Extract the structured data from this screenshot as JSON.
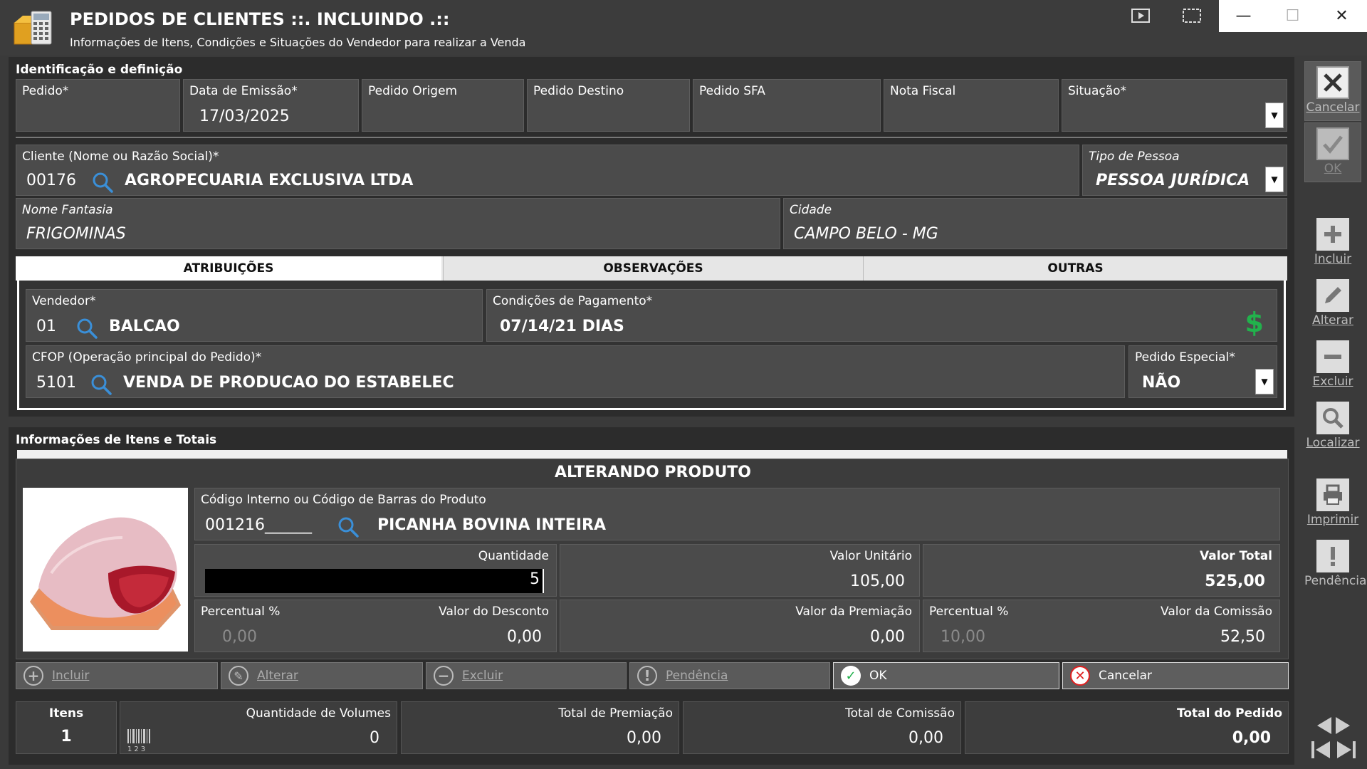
{
  "window": {
    "title": "PEDIDOS DE CLIENTES ::. INCLUINDO .::",
    "subtitle": "Informações de Itens, Condições e Situações do Vendedor para realizar a Venda",
    "minimize": "—",
    "maximize": "☐",
    "close": "✕"
  },
  "identificacao": {
    "section_title": "Identificação e definição",
    "pedido_label": "Pedido*",
    "pedido_value": "",
    "data_label": "Data de Emissão*",
    "data_value": "17/03/2025",
    "origem_label": "Pedido Origem",
    "origem_value": "",
    "destino_label": "Pedido Destino",
    "destino_value": "",
    "sfa_label": "Pedido SFA",
    "sfa_value": "",
    "nf_label": "Nota Fiscal",
    "nf_value": "",
    "situacao_label": "Situação*",
    "situacao_value": "",
    "cliente_label": "Cliente (Nome ou Razão Social)*",
    "cliente_code": "00176",
    "cliente_name": "AGROPECUARIA EXCLUSIVA LTDA",
    "tipo_label": "Tipo de Pessoa",
    "tipo_value": "PESSOA JURÍDICA",
    "fantasia_label": "Nome Fantasia",
    "fantasia_value": "FRIGOMINAS",
    "cidade_label": "Cidade",
    "cidade_value": "CAMPO BELO - MG"
  },
  "tabs": {
    "atribuicoes": "ATRIBUIÇÕES",
    "observacoes": "OBSERVAÇÕES",
    "outras": "OUTRAS"
  },
  "atribuicoes": {
    "vendedor_label": "Vendedor*",
    "vendedor_code": "01",
    "vendedor_name": "BALCAO",
    "condicoes_label": "Condições de Pagamento*",
    "condicoes_value": "07/14/21 DIAS",
    "cfop_label": "CFOP (Operação principal do Pedido)*",
    "cfop_code": "5101",
    "cfop_name": "VENDA DE PRODUCAO DO ESTABELEC",
    "especial_label": "Pedido Especial*",
    "especial_value": "NÃO"
  },
  "itens": {
    "section_title": "Informações de Itens e Totais"
  },
  "produto": {
    "title": "ALTERANDO PRODUTO",
    "codigo_label": "Código Interno ou Código de Barras do Produto",
    "codigo_value": "001216______",
    "produto_name": "PICANHA BOVINA INTEIRA",
    "quantidade_label": "Quantidade",
    "quantidade_value": "5",
    "valor_unit_label": "Valor Unitário",
    "valor_unit_value": "105,00",
    "valor_total_label": "Valor Total",
    "valor_total_value": "525,00",
    "perc_desc_label": "Percentual %",
    "perc_desc_value": "0,00",
    "desconto_label": "Valor do Desconto",
    "desconto_value": "0,00",
    "premiacao_label": "Valor da Premiação",
    "premiacao_value": "0,00",
    "perc_com_label": "Percentual %",
    "perc_com_value": "10,00",
    "comissao_label": "Valor da Comissão",
    "comissao_value": "52,50"
  },
  "acoes": {
    "incluir": "Incluir",
    "alterar": "Alterar",
    "excluir": "Excluir",
    "pendencia": "Pendência",
    "ok": "OK",
    "cancelar": "Cancelar"
  },
  "totais": {
    "itens_label": "Itens",
    "itens_value": "1",
    "volumes_label": "Quantidade de Volumes",
    "volumes_value": "0",
    "barcode_caption": "123",
    "premiacao_label": "Total de Premiação",
    "premiacao_value": "0,00",
    "comissao_label": "Total de Comissão",
    "comissao_value": "0,00",
    "pedido_label": "Total do Pedido",
    "pedido_value": "0,00"
  },
  "sidebar": {
    "cancelar": "Cancelar",
    "ok": "OK",
    "incluir": "Incluir",
    "alterar": "Alterar",
    "excluir": "Excluir",
    "localizar": "Localizar",
    "imprimir": "Imprimir",
    "pendencia": "Pendência"
  },
  "colors": {
    "background": "#3a3a3a",
    "panel": "#4b4b4b",
    "accent_green": "#22b14c",
    "cancel_red": "#e02020"
  }
}
